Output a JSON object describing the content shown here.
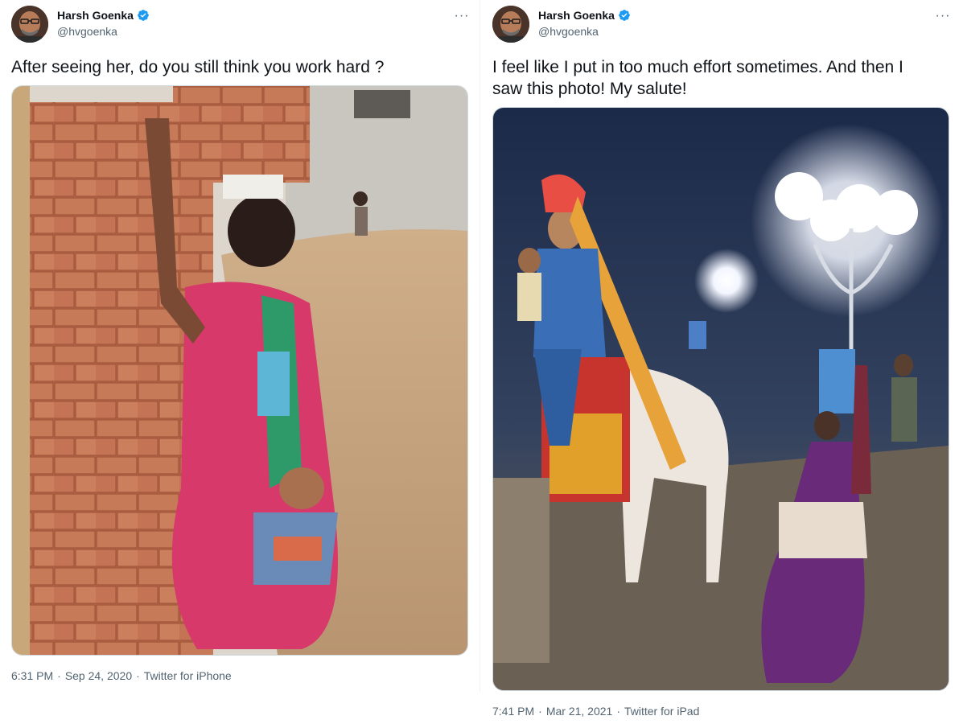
{
  "colors": {
    "text_primary": "#0f1419",
    "text_secondary": "#536471",
    "verified_blue": "#1d9bf0",
    "border": "#cfd9de"
  },
  "tweets": [
    {
      "author": {
        "name": "Harsh Goenka",
        "handle": "@hvgoenka",
        "verified": true
      },
      "more_icon": "more-horizontal-icon",
      "text": "After seeing her, do you still think you work hard ?",
      "time": "6:31 PM",
      "separator": "·",
      "date": "Sep 24, 2020",
      "source": "Twitter for iPhone"
    },
    {
      "author": {
        "name": "Harsh Goenka",
        "handle": "@hvgoenka",
        "verified": true
      },
      "more_icon": "more-horizontal-icon",
      "text_line1": "I feel like I put in too much effort sometimes. And then I",
      "text_line2": "saw this photo! My salute!",
      "time": "7:41 PM",
      "separator": "·",
      "date": "Mar 21, 2021",
      "source": "Twitter for iPad"
    }
  ]
}
